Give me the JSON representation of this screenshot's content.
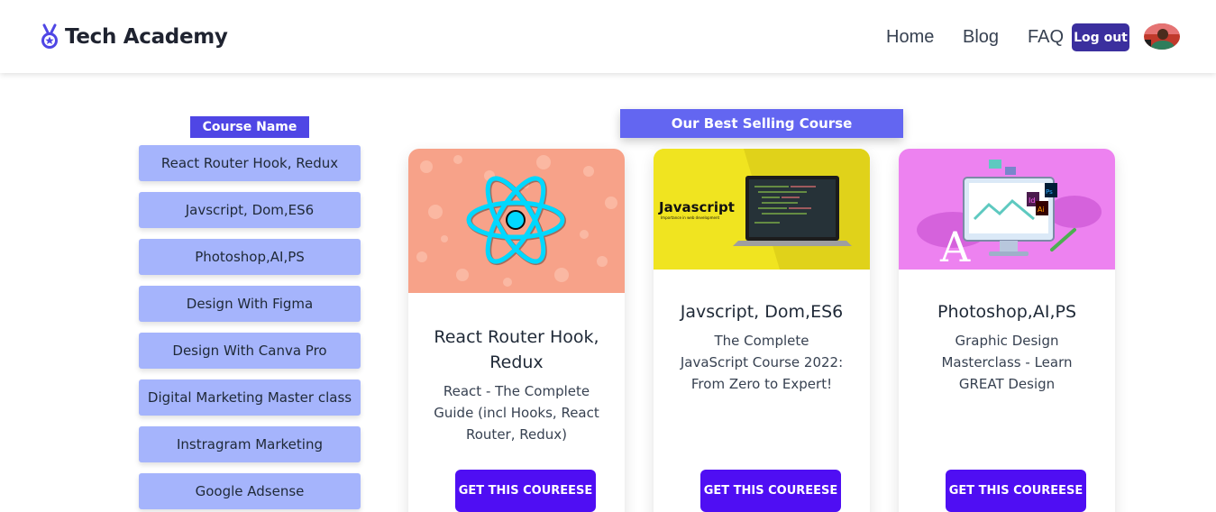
{
  "header": {
    "brand": "Tech Academy",
    "nav": [
      "Home",
      "Blog",
      "FAQ"
    ],
    "logout_label": "Log out"
  },
  "sidebar": {
    "heading": "Course Name",
    "items": [
      "React Router Hook, Redux",
      "Javscript, Dom,ES6",
      "Photoshop,AI,PS",
      "Design With Figma",
      "Design With Canva Pro",
      "Digital Marketing Master class",
      "Instragram Marketing",
      "Google Adsense"
    ]
  },
  "main": {
    "heading": "Our Best Selling Course",
    "cards": [
      {
        "title": "React Router Hook, Redux",
        "description": "React - The Complete Guide (incl Hooks, React Router, Redux)",
        "cta": "GET THIS COUREESE",
        "thumb_label": ""
      },
      {
        "title": "Javscript, Dom,ES6",
        "description": "The Complete JavaScript Course 2022: From Zero to Expert!",
        "cta": "GET THIS COUREESE",
        "thumb_label": "Javascript",
        "thumb_sublabel": "Importance in web development"
      },
      {
        "title": "Photoshop,AI,PS",
        "description": "Graphic Design Masterclass - Learn GREAT Design",
        "cta": "GET THIS COUREESE",
        "thumb_label": ""
      }
    ]
  },
  "colors": {
    "accent": "#4f46e5",
    "cta": "#4f0ef3",
    "sidebar_item": "#a5b4fc",
    "logout": "#3b2f9e"
  }
}
